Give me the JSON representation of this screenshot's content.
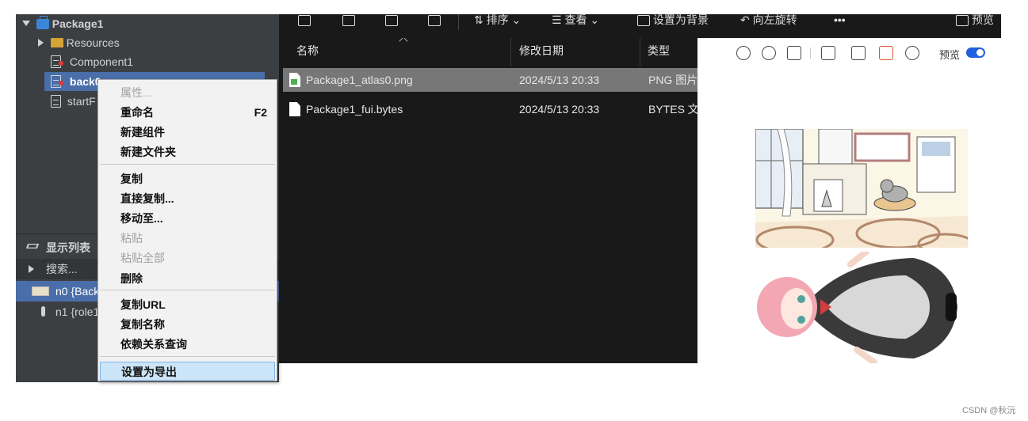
{
  "left_panel": {
    "package_name": "Package1",
    "tree": {
      "resources": "Resources",
      "component1": "Component1",
      "back_truncated": "back0",
      "start_truncated": "startF"
    },
    "display_list": {
      "title": "显示列表",
      "search": "搜索...",
      "items": [
        "n0 {Back",
        "n1 {role1"
      ]
    }
  },
  "context_menu": {
    "properties": "属性...",
    "rename": "重命名",
    "rename_shortcut": "F2",
    "new_component": "新建组件",
    "new_folder": "新建文件夹",
    "copy": "复制",
    "duplicate": "直接复制...",
    "move_to": "移动至...",
    "paste": "粘贴",
    "paste_all": "粘贴全部",
    "delete": "删除",
    "copy_url": "复制URL",
    "copy_name": "复制名称",
    "dependency_query": "依赖关系查询",
    "set_export": "设置为导出"
  },
  "explorer": {
    "toolbar": {
      "sort": "排序",
      "view": "查看",
      "set_background": "设置为背景",
      "rotate_left": "向左旋转",
      "more": "•••",
      "preview": "预览"
    },
    "columns": {
      "name": "名称",
      "modified": "修改日期",
      "type": "类型"
    },
    "files": [
      {
        "name": "Package1_atlas0.png",
        "date": "2024/5/13 20:33",
        "type": "PNG 图片",
        "selected": true
      },
      {
        "name": "Package1_fui.bytes",
        "date": "2024/5/13 20:33",
        "type": "BYTES 文",
        "selected": false
      }
    ]
  },
  "preview_pane": {
    "preview_label": "预览",
    "toggle_on": true,
    "accent_color": "#1f5fe0"
  },
  "watermark": "CSDN @秋沅"
}
